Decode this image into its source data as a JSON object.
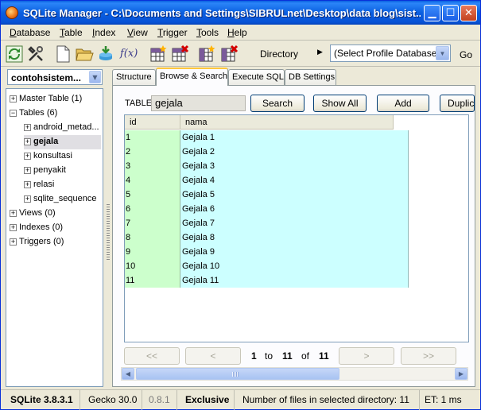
{
  "window": {
    "title": "SQLite Manager - C:\\Documents and Settings\\SIBRULnet\\Desktop\\data blog\\sist..."
  },
  "menubar": {
    "items": [
      "Database",
      "Table",
      "Index",
      "View",
      "Trigger",
      "Tools",
      "Help"
    ]
  },
  "toolbar": {
    "directory_label": "Directory",
    "profile_select_value": "(Select Profile Database)",
    "go_label": "Go",
    "function_icon_text": "f(x)"
  },
  "sidebar": {
    "database_name": "contohsistem...",
    "tree": [
      {
        "label": "Master Table (1)",
        "expander": "+"
      },
      {
        "label": "Tables (6)",
        "expander": "−"
      },
      {
        "label": "android_metad...",
        "expander": "+"
      },
      {
        "label": "gejala",
        "expander": "+"
      },
      {
        "label": "konsultasi",
        "expander": "+"
      },
      {
        "label": "penyakit",
        "expander": "+"
      },
      {
        "label": "relasi",
        "expander": "+"
      },
      {
        "label": "sqlite_sequence",
        "expander": "+"
      },
      {
        "label": "Views (0)",
        "expander": "+"
      },
      {
        "label": "Indexes (0)",
        "expander": "+"
      },
      {
        "label": "Triggers (0)",
        "expander": "+"
      }
    ]
  },
  "tabs": [
    "Structure",
    "Browse & Search",
    "Execute SQL",
    "DB Settings"
  ],
  "browse": {
    "table_label": "TABLE",
    "table_name": "gejala",
    "buttons": {
      "search": "Search",
      "show_all": "Show All",
      "add": "Add",
      "duplicate": "Duplic"
    },
    "columns": [
      "id",
      "nama"
    ],
    "rows": [
      [
        "1",
        "Gejala 1"
      ],
      [
        "2",
        "Gejala 2"
      ],
      [
        "3",
        "Gejala 3"
      ],
      [
        "4",
        "Gejala 4"
      ],
      [
        "5",
        "Gejala 5"
      ],
      [
        "6",
        "Gejala 6"
      ],
      [
        "7",
        "Gejala 7"
      ],
      [
        "8",
        "Gejala 8"
      ],
      [
        "9",
        "Gejala 9"
      ],
      [
        "10",
        "Gejala 10"
      ],
      [
        "11",
        "Gejala 11"
      ]
    ],
    "pager": {
      "first": "<<",
      "prev": "<",
      "next": ">",
      "last": ">>",
      "from": "1",
      "to_word": "to",
      "to": "11",
      "of_word": "of",
      "total": "11"
    }
  },
  "statusbar": {
    "sqlite_version": "SQLite 3.8.3.1",
    "gecko_version": "Gecko 30.0",
    "ext_version": "0.8.1",
    "lock_mode": "Exclusive",
    "files_info": "Number of files in selected directory: 11",
    "et": "ET: 1 ms"
  },
  "colors": {
    "title_bar": "#0a5fe0",
    "id_cell_bg": "#ccffcc",
    "nama_cell_bg": "#ccffff",
    "active_tab_accent": "#ffc83c"
  }
}
